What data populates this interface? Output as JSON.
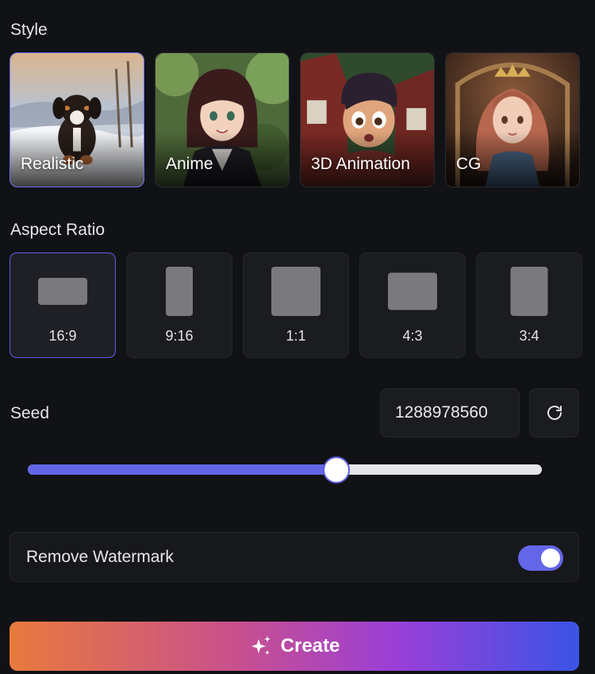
{
  "style": {
    "label": "Style",
    "options": [
      {
        "label": "Realistic",
        "selected": true
      },
      {
        "label": "Anime",
        "selected": false
      },
      {
        "label": "3D Animation",
        "selected": false
      },
      {
        "label": "CG",
        "selected": false
      }
    ]
  },
  "aspect_ratio": {
    "label": "Aspect Ratio",
    "options": [
      {
        "label": "16:9",
        "selected": true
      },
      {
        "label": "9:16",
        "selected": false
      },
      {
        "label": "1:1",
        "selected": false
      },
      {
        "label": "4:3",
        "selected": false
      },
      {
        "label": "3:4",
        "selected": false
      }
    ]
  },
  "seed": {
    "label": "Seed",
    "value": "1288978560",
    "slider_fraction": 0.6
  },
  "watermark": {
    "label": "Remove Watermark",
    "enabled": true
  },
  "create": {
    "label": "Create"
  },
  "colors": {
    "accent": "#6466e8",
    "background": "#111215"
  }
}
